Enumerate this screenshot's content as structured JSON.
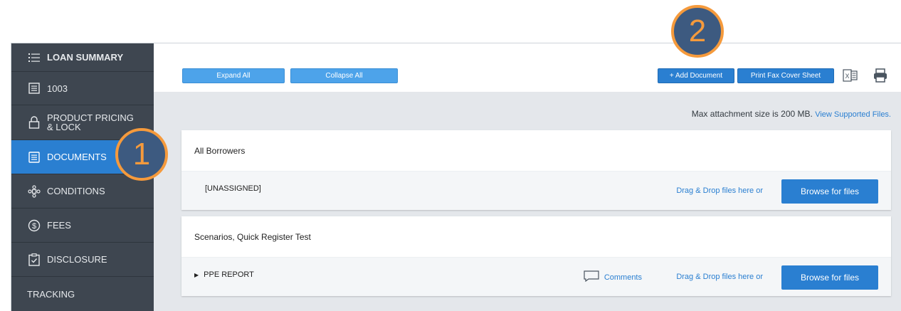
{
  "sidebar": {
    "items": [
      {
        "label": "LOAN SUMMARY",
        "icon": "list-icon"
      },
      {
        "label": "1003",
        "icon": "form-icon"
      },
      {
        "label_line1": "PRODUCT PRICING",
        "label_line2": "& LOCK",
        "icon": "lock-icon"
      },
      {
        "label": "DOCUMENTS",
        "icon": "documents-icon"
      },
      {
        "label": "CONDITIONS",
        "icon": "conditions-icon"
      },
      {
        "label": "FEES",
        "icon": "dollar-circle-icon"
      },
      {
        "label": "DISCLOSURE",
        "icon": "clipboard-check-icon"
      },
      {
        "label": "TRACKING"
      }
    ]
  },
  "toolbar": {
    "expand_all": "Expand All",
    "collapse_all": "Collapse All",
    "add_document": "+ Add Document",
    "print_fax": "Print Fax Cover Sheet"
  },
  "info": {
    "max_size": "Max attachment size is 200 MB.",
    "view_supported": "View Supported Files."
  },
  "cards": [
    {
      "title": "All Borrowers",
      "row": {
        "label": "[UNASSIGNED]",
        "drag_drop": "Drag & Drop files here or",
        "browse": "Browse for files"
      }
    },
    {
      "title": "Scenarios, Quick Register Test",
      "row": {
        "label": "PPE REPORT",
        "comments": "Comments",
        "drag_drop": "Drag & Drop files here or",
        "browse": "Browse for files"
      }
    }
  ],
  "callouts": {
    "one": "1",
    "two": "2"
  },
  "colors": {
    "sidebar_bg": "#3e4650",
    "active": "#2a7fd1",
    "button": "#4da3ea",
    "callout_ring": "#f59a3c",
    "callout_fill": "#3d5a80"
  }
}
